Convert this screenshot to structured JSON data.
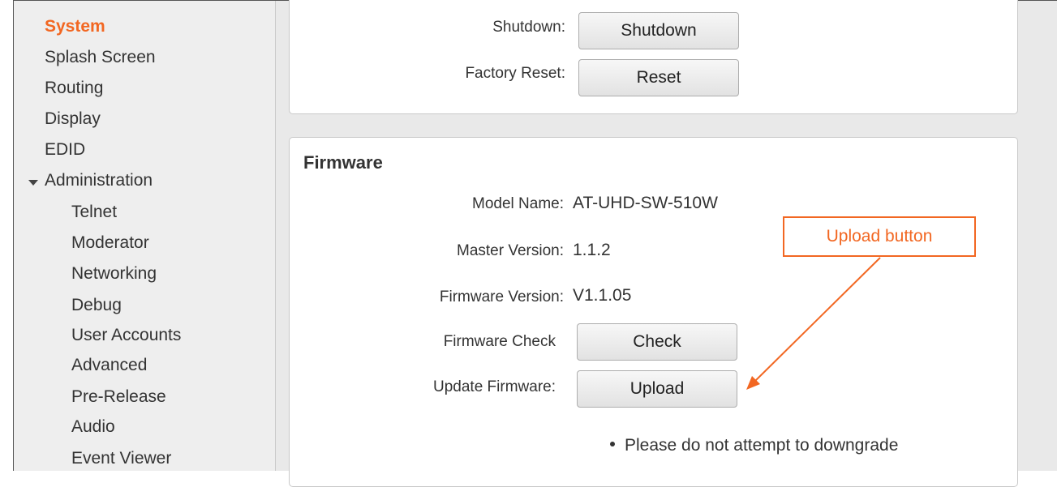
{
  "sidebar": {
    "items": [
      {
        "label": "System",
        "active": true
      },
      {
        "label": "Splash Screen"
      },
      {
        "label": "Routing"
      },
      {
        "label": "Display"
      },
      {
        "label": "EDID"
      },
      {
        "label": "Administration",
        "expanded": true
      },
      {
        "label": "Telnet"
      },
      {
        "label": "Moderator"
      },
      {
        "label": "Networking"
      },
      {
        "label": "Debug"
      },
      {
        "label": "User Accounts"
      },
      {
        "label": "Advanced"
      },
      {
        "label": "Pre-Release"
      },
      {
        "label": "Audio"
      },
      {
        "label": "Event Viewer"
      }
    ]
  },
  "system_panel": {
    "shutdown": {
      "label": "Shutdown:",
      "button": "Shutdown"
    },
    "factory_reset": {
      "label": "Factory Reset:",
      "button": "Reset"
    }
  },
  "firmware": {
    "title": "Firmware",
    "model_name": {
      "label": "Model Name:",
      "value": "AT-UHD-SW-510W"
    },
    "master_version": {
      "label": "Master Version:",
      "value": "1.1.2"
    },
    "firmware_version": {
      "label": "Firmware Version:",
      "value": "V1.1.05"
    },
    "firmware_check": {
      "label": "Firmware Check",
      "button": "Check"
    },
    "update_firmware": {
      "label": "Update Firmware:",
      "button": "Upload"
    },
    "notes": [
      "Please do not attempt to downgrade"
    ]
  },
  "annotation": {
    "text": "Upload button",
    "color": "#f26722"
  },
  "colors": {
    "accent": "#f26722",
    "sidebar_bg": "#eeeeee",
    "main_bg": "#e9e9e9"
  }
}
